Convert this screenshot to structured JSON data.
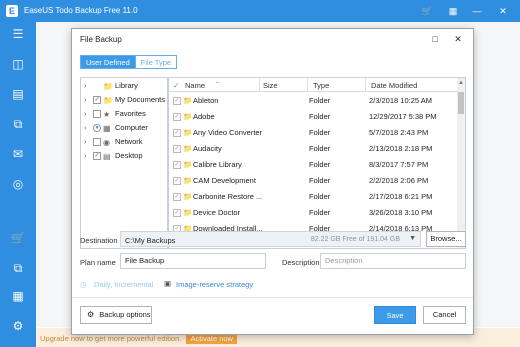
{
  "app": {
    "title": "EaseUS Todo Backup Free 11.0",
    "upgrade_text": "Upgrade now to get more powerful edition.",
    "activate_label": "Activate now"
  },
  "dialog": {
    "title": "File Backup",
    "tabs": [
      "User Defined",
      "File Type"
    ],
    "tree": [
      {
        "label": "Library"
      },
      {
        "label": "My Documents"
      },
      {
        "label": "Favorites"
      },
      {
        "label": "Computer"
      },
      {
        "label": "Network"
      },
      {
        "label": "Desktop"
      }
    ],
    "columns": [
      "Name",
      "Size",
      "Type",
      "Date Modified"
    ],
    "rows": [
      {
        "name": "Ableton",
        "size": "",
        "type": "Folder",
        "date": "2/3/2018 10:25 AM"
      },
      {
        "name": "Adobe",
        "size": "",
        "type": "Folder",
        "date": "12/29/2017 5:38 PM"
      },
      {
        "name": "Any Video Converter",
        "size": "",
        "type": "Folder",
        "date": "5/7/2018 2:43 PM"
      },
      {
        "name": "Audacity",
        "size": "",
        "type": "Folder",
        "date": "2/13/2018 2:18 PM"
      },
      {
        "name": "Calibre Library",
        "size": "",
        "type": "Folder",
        "date": "8/3/2017 7:57 PM"
      },
      {
        "name": "CAM Development",
        "size": "",
        "type": "Folder",
        "date": "2/2/2018 2:06 PM"
      },
      {
        "name": "Carbonite Restore ...",
        "size": "",
        "type": "Folder",
        "date": "2/17/2018 6:21 PM"
      },
      {
        "name": "Device Doctor",
        "size": "",
        "type": "Folder",
        "date": "3/26/2018 3:10 PM"
      },
      {
        "name": "Downloaded Install...",
        "size": "",
        "type": "Folder",
        "date": "2/14/2018 6:13 PM"
      }
    ],
    "destination_label": "Destination",
    "destination_value": "C:\\My Backups",
    "free_space": "82.22 GB Free of 191.04 GB",
    "browse_label": "Browse...",
    "plan_label": "Plan name",
    "plan_value": "File Backup",
    "description_label": "Description",
    "description_placeholder": "Description",
    "schedule_link": "Daily, Incremental",
    "strategy_link": "Image-reserve strategy",
    "backup_options_label": "Backup options",
    "save_label": "Save",
    "cancel_label": "Cancel"
  },
  "colors": {
    "accent": "#2f8ee0",
    "tab_active": "#3d9ae8",
    "upgrade_bg": "#fbeedd"
  },
  "icons": [
    "menu-icon",
    "backup-disk-icon",
    "system-backup-icon",
    "file-backup-icon",
    "mail-backup-icon",
    "smart-backup-icon",
    "tools-icon",
    "clone-icon",
    "browse-recover-icon",
    "settings-icon",
    "cart-icon",
    "folder-icon",
    "gear-icon",
    "image-icon"
  ]
}
